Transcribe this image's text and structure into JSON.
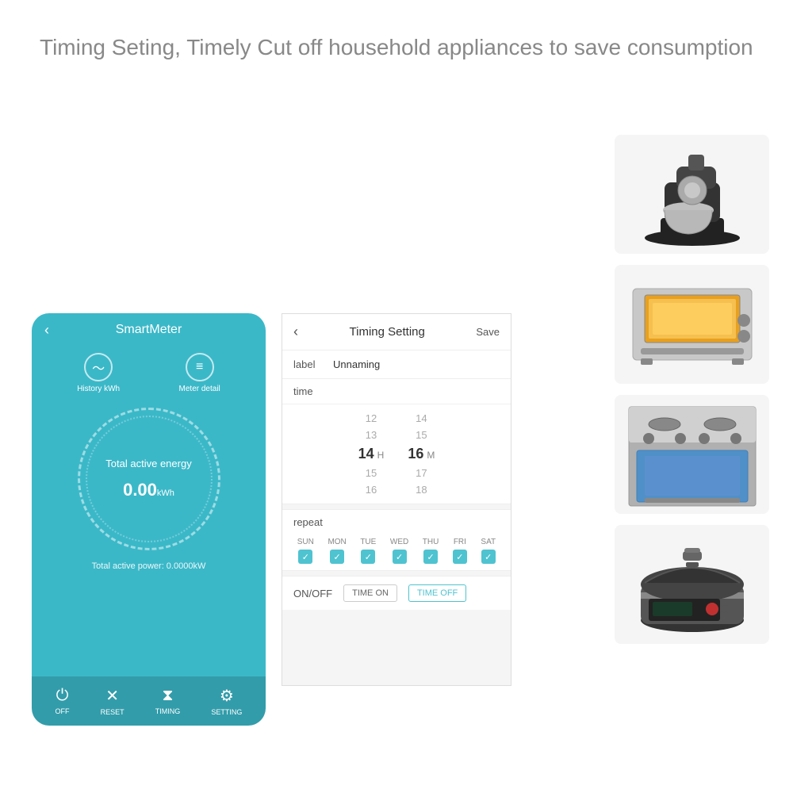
{
  "header": {
    "title": "Timing Seting, Timely Cut off household appliances to save consumption"
  },
  "phone": {
    "back_icon": "‹",
    "title": "SmartMeter",
    "history_label": "History kWh",
    "meter_detail_label": "Meter detail",
    "gauge_title": "Total active\nenergy",
    "gauge_value": "0.00",
    "gauge_unit": "kWh",
    "power_text": "Total active power: 0.0000kW",
    "footer": [
      {
        "id": "off",
        "label": "OFF",
        "icon": "⏻"
      },
      {
        "id": "reset",
        "label": "RESET",
        "icon": "✕"
      },
      {
        "id": "timing",
        "label": "TIMING",
        "icon": "⧖"
      },
      {
        "id": "setting",
        "label": "SETTING",
        "icon": "⚙"
      }
    ]
  },
  "timing": {
    "back_icon": "‹",
    "title": "Timing Setting",
    "save_label": "Save",
    "label_key": "label",
    "label_value": "Unnaming",
    "time_key": "time",
    "time_hours": [
      "12",
      "13",
      "14",
      "15",
      "16"
    ],
    "time_mins": [
      "14",
      "15",
      "16",
      "17",
      "18"
    ],
    "selected_hour": "14",
    "selected_min": "16",
    "hour_suffix": "H",
    "min_suffix": "M",
    "repeat_label": "repeat",
    "days": [
      "SUN",
      "MON",
      "TUE",
      "WED",
      "THU",
      "FRI",
      "SAT"
    ],
    "onoff_label": "ON/OFF",
    "btn_time_on": "TIME ON",
    "btn_time_off": "TIME OFF"
  },
  "colors": {
    "phone_bg": "#3bb8c8",
    "panel_bg": "#f5f5f5",
    "accent": "#4fc3d0"
  }
}
